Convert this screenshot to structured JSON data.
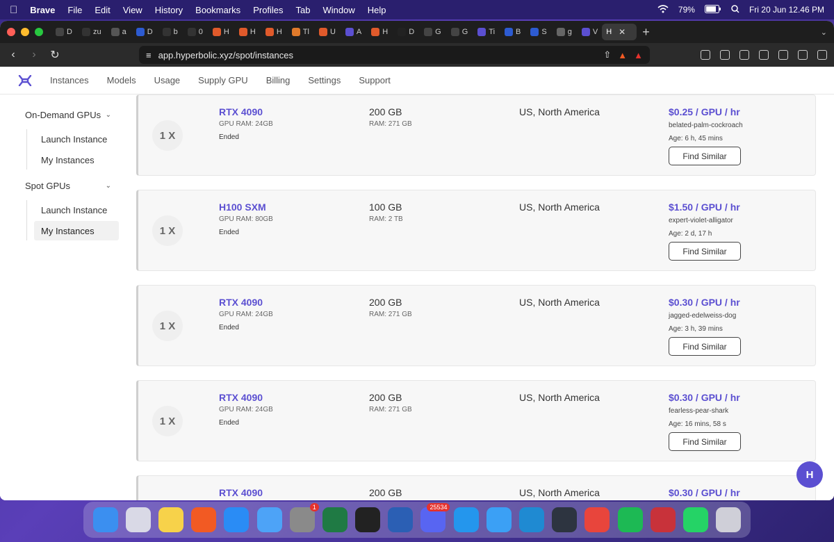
{
  "menubar": {
    "app": "Brave",
    "items": [
      "File",
      "Edit",
      "View",
      "History",
      "Bookmarks",
      "Profiles",
      "Tab",
      "Window",
      "Help"
    ],
    "battery": "79%",
    "datetime": "Fri 20 Jun  12.46 PM"
  },
  "browser": {
    "tabs": [
      {
        "label": "D",
        "color": "#444444"
      },
      {
        "label": "zu",
        "color": "#333333"
      },
      {
        "label": "a",
        "color": "#555555"
      },
      {
        "label": "D",
        "color": "#2d5bd1"
      },
      {
        "label": "b",
        "color": "#333333"
      },
      {
        "label": "0",
        "color": "#333333"
      },
      {
        "label": "H",
        "color": "#e05a2b"
      },
      {
        "label": "H",
        "color": "#e05a2b"
      },
      {
        "label": "H",
        "color": "#e05a2b"
      },
      {
        "label": "Tl",
        "color": "#e07a2b"
      },
      {
        "label": "U",
        "color": "#e05a2b"
      },
      {
        "label": "A",
        "color": "#5b4fd1"
      },
      {
        "label": "H",
        "color": "#e05a2b"
      },
      {
        "label": "D",
        "color": "#222222"
      },
      {
        "label": "G",
        "color": "#444444"
      },
      {
        "label": "G",
        "color": "#444444"
      },
      {
        "label": "Ti",
        "color": "#5b4fd1"
      },
      {
        "label": "B",
        "color": "#2d5bd1"
      },
      {
        "label": "S",
        "color": "#2d5bd1"
      },
      {
        "label": "g",
        "color": "#666666"
      },
      {
        "label": "V",
        "color": "#5b4fd1"
      }
    ],
    "active_tab": "H",
    "url": "app.hyperbolic.xyz/spot/instances"
  },
  "app": {
    "nav": [
      "Instances",
      "Models",
      "Usage",
      "Supply GPU",
      "Billing",
      "Settings",
      "Support"
    ],
    "sidebar": [
      {
        "group": "On-Demand GPUs",
        "items": [
          "Launch Instance",
          "My Instances"
        ]
      },
      {
        "group": "Spot GPUs",
        "items": [
          "Launch Instance",
          "My Instances"
        ]
      }
    ],
    "cards": [
      {
        "qty": "1 X",
        "gpu": "RTX 4090",
        "gpu_ram": "GPU RAM: 24GB",
        "status": "Ended",
        "storage": "200 GB",
        "ram": "RAM:  271 GB",
        "region": "US, North America",
        "price": "$0.25 / GPU / hr",
        "name": "belated-palm-cockroach",
        "age": "Age: 6 h, 45 mins",
        "button": "Find Similar"
      },
      {
        "qty": "1 X",
        "gpu": "H100 SXM",
        "gpu_ram": "GPU RAM: 80GB",
        "status": "Ended",
        "storage": "100 GB",
        "ram": "RAM:  2 TB",
        "region": "US, North America",
        "price": "$1.50 / GPU / hr",
        "name": "expert-violet-alligator",
        "age": "Age: 2 d, 17 h",
        "button": "Find Similar"
      },
      {
        "qty": "1 X",
        "gpu": "RTX 4090",
        "gpu_ram": "GPU RAM: 24GB",
        "status": "Ended",
        "storage": "200 GB",
        "ram": "RAM:  271 GB",
        "region": "US, North America",
        "price": "$0.30 / GPU / hr",
        "name": "jagged-edelweiss-dog",
        "age": "Age: 3 h, 39 mins",
        "button": "Find Similar"
      },
      {
        "qty": "1 X",
        "gpu": "RTX 4090",
        "gpu_ram": "GPU RAM: 24GB",
        "status": "Ended",
        "storage": "200 GB",
        "ram": "RAM:  271 GB",
        "region": "US, North America",
        "price": "$0.30 / GPU / hr",
        "name": "fearless-pear-shark",
        "age": "Age: 16 mins, 58 s",
        "button": "Find Similar"
      },
      {
        "qty": "1 X",
        "gpu": "RTX 4090",
        "gpu_ram": "",
        "status": "",
        "storage": "200 GB",
        "ram": "",
        "region": "US, North America",
        "price": "$0.30 / GPU / hr",
        "name": "",
        "age": "",
        "button": ""
      }
    ],
    "chat_label": "H"
  },
  "dock": {
    "apps": [
      {
        "name": "finder",
        "color": "#3b8ff0"
      },
      {
        "name": "launchpad",
        "color": "#d9d9e6"
      },
      {
        "name": "notes",
        "color": "#f7d24a"
      },
      {
        "name": "brave",
        "color": "#f25a23"
      },
      {
        "name": "app-store",
        "color": "#2a8cf5"
      },
      {
        "name": "mail",
        "color": "#4da3f7"
      },
      {
        "name": "system-settings",
        "color": "#8a8a8a",
        "badge": "1"
      },
      {
        "name": "excel",
        "color": "#1f7a44"
      },
      {
        "name": "terminal",
        "color": "#222222"
      },
      {
        "name": "word",
        "color": "#2b5fb4"
      },
      {
        "name": "discord",
        "color": "#5865f2",
        "badge": "25534"
      },
      {
        "name": "docker",
        "color": "#2496ed"
      },
      {
        "name": "safari",
        "color": "#3ba0f5"
      },
      {
        "name": "vscode",
        "color": "#1f8ad2"
      },
      {
        "name": "cloud",
        "color": "#2d3440"
      },
      {
        "name": "chrome",
        "color": "#e8453c"
      },
      {
        "name": "spotify",
        "color": "#1db954"
      },
      {
        "name": "photo-booth",
        "color": "#c8323a"
      },
      {
        "name": "whatsapp",
        "color": "#25d366"
      },
      {
        "name": "trash",
        "color": "#cfcfd8"
      }
    ]
  }
}
